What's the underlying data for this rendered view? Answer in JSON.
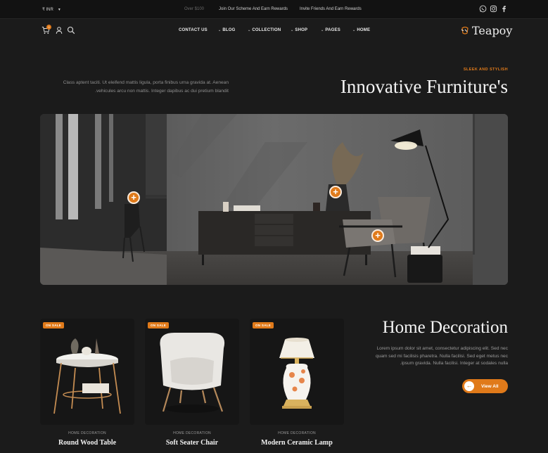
{
  "topbar": {
    "currency": "₹ INR",
    "ticker": [
      "Over $100",
      "Join Our Scheme And Earn Rewards",
      "Invite Friends And Earn Rewards"
    ],
    "social_icons": [
      "whatsapp-icon",
      "instagram-icon",
      "facebook-icon"
    ]
  },
  "header": {
    "cart_count": "0",
    "nav": [
      {
        "label": "CONTACT US",
        "dropdown": false
      },
      {
        "label": "BLOG",
        "dropdown": true
      },
      {
        "label": "COLLECTION",
        "dropdown": true
      },
      {
        "label": "SHOP",
        "dropdown": true
      },
      {
        "label": "PAGES",
        "dropdown": true
      },
      {
        "label": "HOME",
        "dropdown": true
      }
    ],
    "logo_text": "Teapoy"
  },
  "hero": {
    "eyebrow": "SLEEK AND STYLISH",
    "title": "Innovative Furniture's",
    "description": "Class aptent taciti. Ut eleifend mattis ligula, porta finibus urna gravida at. Aenean .vehicules arcu non mattis. Integer dapibus ac dui pretium blandit"
  },
  "products": [
    {
      "badge": "ON SALE",
      "category": "HOME DECORATION",
      "name": "Round Wood Table"
    },
    {
      "badge": "ON SALE",
      "category": "HOME DECORATION",
      "name": "Soft Seater Chair"
    },
    {
      "badge": "ON SALE",
      "category": "HOME DECORATION",
      "name": "Modern Ceramic Lamp"
    }
  ],
  "section": {
    "title": "Home Decoration",
    "description": "Lorem ipsum dolor sit amet, consectetur adipiscing elit. Sed nec quam sed mi facilisis pharetra. Nulla facilisi. Sed eget metus nec .ipsum gravida. Nulla facilisi. Integer at sodales nulla",
    "button_label": "View All"
  },
  "colors": {
    "accent": "#e07a1a",
    "background": "#1b1b1b"
  }
}
